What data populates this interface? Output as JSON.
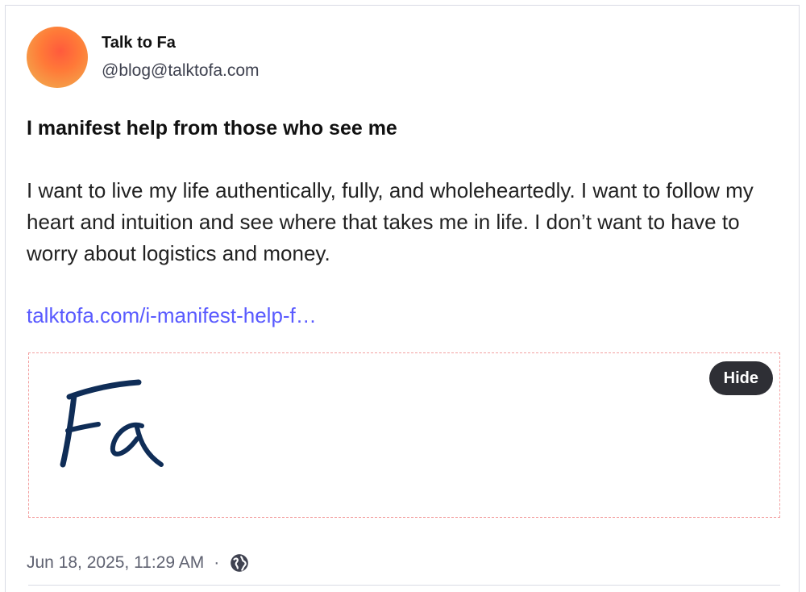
{
  "post": {
    "author": {
      "display_name": "Talk to Fa",
      "handle": "@blog@talktofa.com"
    },
    "title": "I manifest help from those who see me",
    "body": "I want to live my life authentically, fully, and wholeheartedly. I want to follow my heart and intuition and see where that takes me in life. I don’t want to have to worry about logistics and money.",
    "link_text": "talktofa.com/i-manifest-help-f…",
    "media": {
      "logo_text": "Fa",
      "hide_label": "Hide"
    },
    "timestamp": "Jun 18, 2025, 11:29 AM",
    "separator": "·",
    "visibility_icon": "globe-icon"
  },
  "colors": {
    "link": "#595aff",
    "logo": "#0f2d57",
    "hide_button_bg": "#2e2f35",
    "media_border": "#f3a0a0"
  }
}
